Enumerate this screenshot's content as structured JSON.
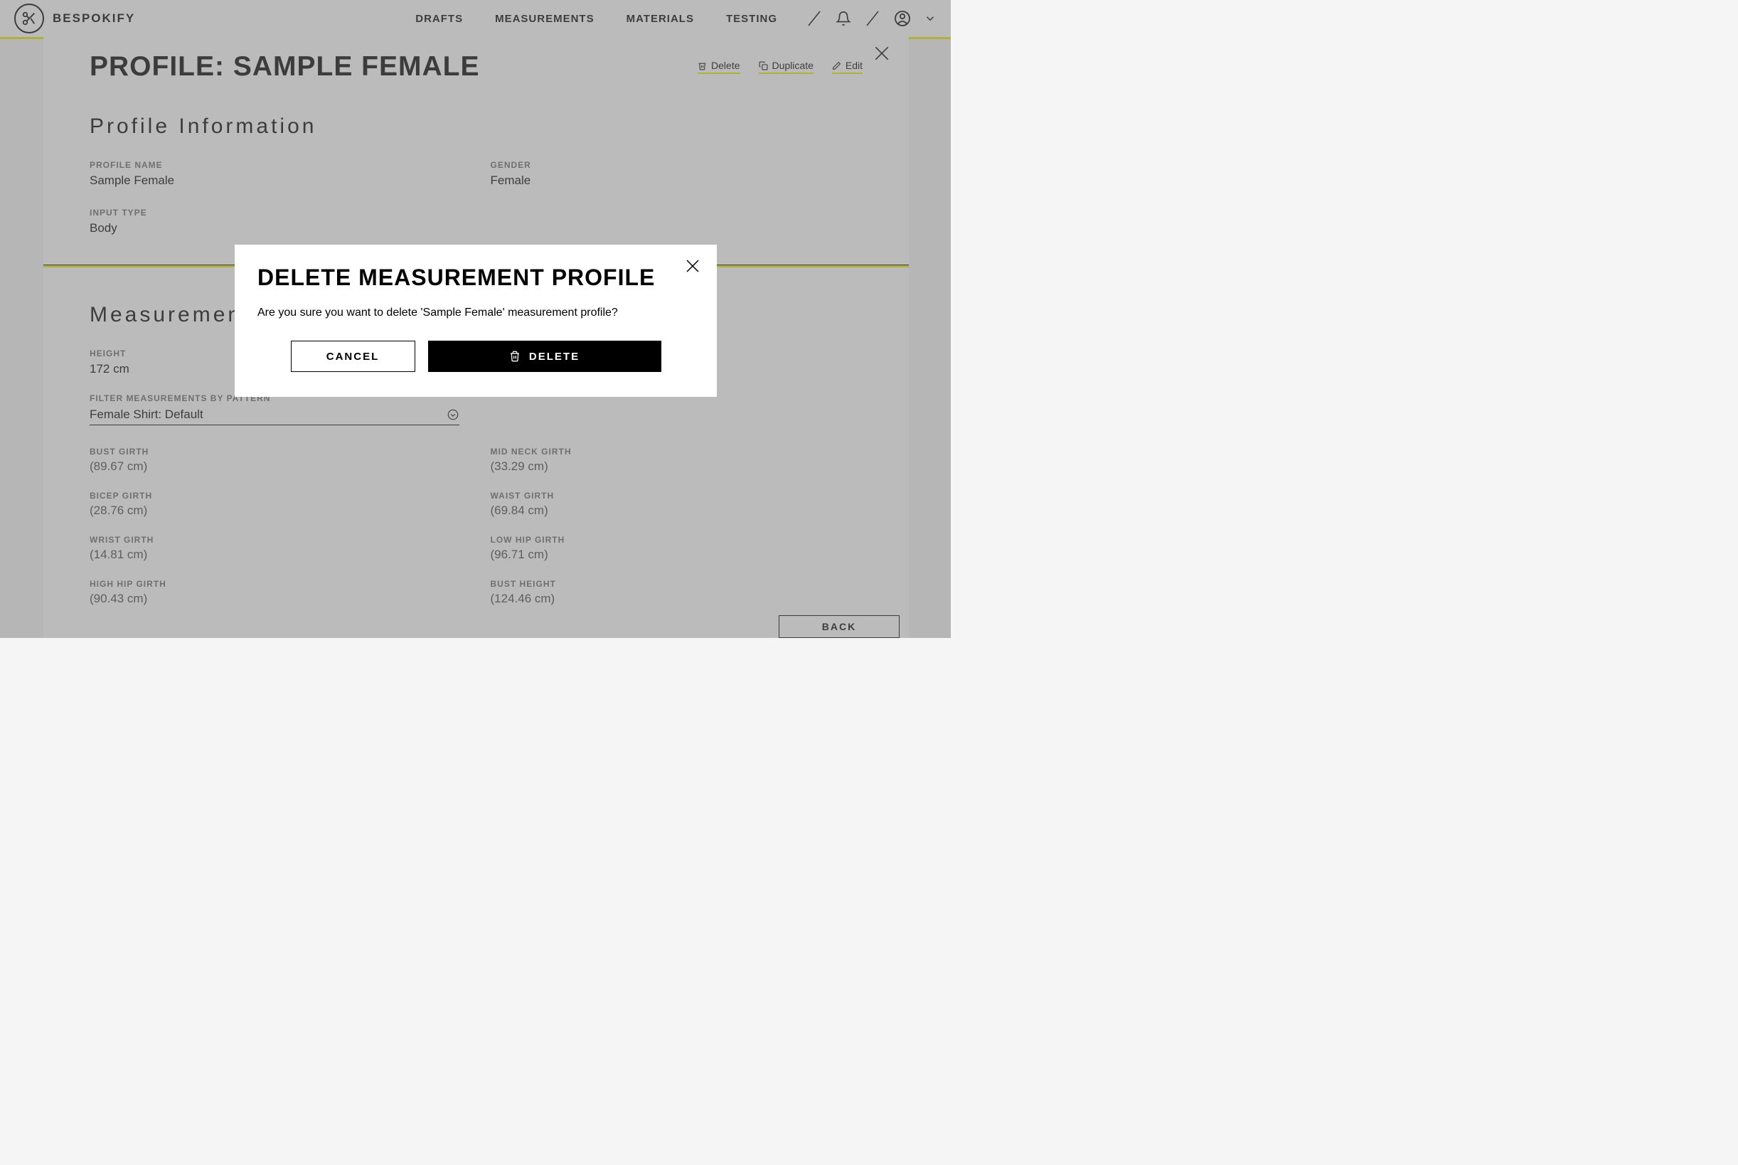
{
  "header": {
    "brand": "BESPOKIFY",
    "nav": [
      "DRAFTS",
      "MEASUREMENTS",
      "MATERIALS",
      "TESTING"
    ]
  },
  "panel": {
    "title": "PROFILE: SAMPLE FEMALE",
    "actions": {
      "delete": "Delete",
      "duplicate": "Duplicate",
      "edit": "Edit"
    },
    "section1_title": "Profile Information",
    "info": {
      "profile_name_label": "PROFILE NAME",
      "profile_name_value": "Sample Female",
      "gender_label": "GENDER",
      "gender_value": "Female",
      "input_type_label": "INPUT TYPE",
      "input_type_value": "Body"
    },
    "section2_title": "Measurements",
    "height_label": "HEIGHT",
    "height_value": "172 cm",
    "filter_label": "FILTER MEASUREMENTS BY PATTERN",
    "filter_value": "Female Shirt: Default",
    "measurements": [
      {
        "label": "BUST GIRTH",
        "value": "(89.67 cm)"
      },
      {
        "label": "MID NECK GIRTH",
        "value": "(33.29 cm)"
      },
      {
        "label": "BICEP GIRTH",
        "value": "(28.76 cm)"
      },
      {
        "label": "WAIST GIRTH",
        "value": "(69.84 cm)"
      },
      {
        "label": "WRIST GIRTH",
        "value": "(14.81 cm)"
      },
      {
        "label": "LOW HIP GIRTH",
        "value": "(96.71 cm)"
      },
      {
        "label": "HIGH HIP GIRTH",
        "value": "(90.43 cm)"
      },
      {
        "label": "BUST HEIGHT",
        "value": "(124.46 cm)"
      }
    ],
    "back_label": "BACK"
  },
  "modal": {
    "title": "DELETE MEASUREMENT PROFILE",
    "text": "Are you sure you want to delete 'Sample Female' measurement profile?",
    "cancel": "CANCEL",
    "delete": "DELETE"
  }
}
